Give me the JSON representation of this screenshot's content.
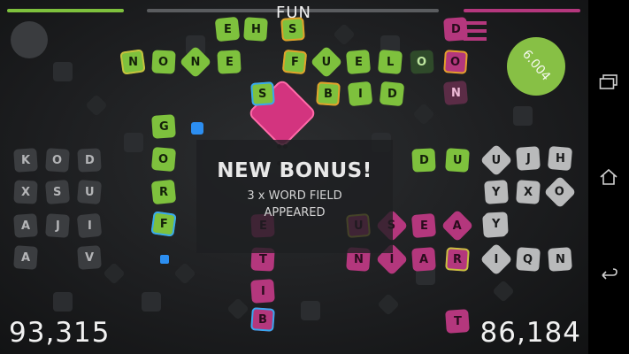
{
  "hud": {
    "current_word": "FUN",
    "timer_value": "6.004",
    "left_score": "93,315",
    "right_score": "86,184",
    "colors": {
      "player_green": "#7ec13d",
      "player_pink": "#b4377d",
      "timer": "#87c045",
      "tile_white": "#b9babb"
    }
  },
  "bonus": {
    "title": "NEW BONUS!",
    "line1": "3 x WORD FIELD",
    "line2": "APPEARED"
  },
  "board_tiles": [
    {
      "letter": "E",
      "style": "t-green"
    },
    {
      "letter": "H",
      "style": "t-green"
    },
    {
      "letter": "S",
      "style": "t-green"
    },
    {
      "letter": "N",
      "style": "t-green"
    },
    {
      "letter": "O",
      "style": "t-green"
    },
    {
      "letter": "N",
      "style": "t-green"
    },
    {
      "letter": "E",
      "style": "t-green"
    },
    {
      "letter": "F",
      "style": "t-green"
    },
    {
      "letter": "U",
      "style": "t-green"
    },
    {
      "letter": "E",
      "style": "t-green"
    },
    {
      "letter": "L",
      "style": "t-green"
    },
    {
      "letter": "O",
      "style": "t-green"
    },
    {
      "letter": "S",
      "style": "t-green"
    },
    {
      "letter": "B",
      "style": "t-green"
    },
    {
      "letter": "I",
      "style": "t-green"
    },
    {
      "letter": "D",
      "style": "t-green"
    },
    {
      "letter": "G",
      "style": "t-green"
    },
    {
      "letter": "O",
      "style": "t-green"
    },
    {
      "letter": "R",
      "style": "t-green"
    },
    {
      "letter": "F",
      "style": "t-green"
    },
    {
      "letter": "D",
      "style": "t-pink"
    },
    {
      "letter": "O",
      "style": "t-pink"
    },
    {
      "letter": "N",
      "style": "t-pink"
    },
    {
      "letter": "D",
      "style": "t-green"
    },
    {
      "letter": "U",
      "style": "t-green"
    },
    {
      "letter": "E",
      "style": "t-pink"
    },
    {
      "letter": "T",
      "style": "t-pink"
    },
    {
      "letter": "I",
      "style": "t-pink"
    },
    {
      "letter": "B",
      "style": "t-pink"
    },
    {
      "letter": "U",
      "style": "t-pink"
    },
    {
      "letter": "S",
      "style": "t-pink"
    },
    {
      "letter": "E",
      "style": "t-pink"
    },
    {
      "letter": "A",
      "style": "t-pink"
    },
    {
      "letter": "Y",
      "style": "t-pink"
    },
    {
      "letter": "N",
      "style": "t-pink"
    },
    {
      "letter": "I",
      "style": "t-pink"
    },
    {
      "letter": "A",
      "style": "t-pink"
    },
    {
      "letter": "R",
      "style": "t-pink"
    },
    {
      "letter": "T",
      "style": "t-pink"
    },
    {
      "letter": "T",
      "style": "t-pink"
    }
  ],
  "left_rack": [
    "K",
    "O",
    "D",
    "X",
    "S",
    "U",
    "A",
    "J",
    "I",
    "A",
    "V"
  ],
  "right_rack": [
    "U",
    "J",
    "H",
    "Y",
    "X",
    "O",
    "Y",
    "I",
    "Q",
    "N"
  ],
  "nav": {
    "recent_icon": "recent-apps-icon",
    "home_icon": "home-icon",
    "back_icon": "back-icon"
  }
}
